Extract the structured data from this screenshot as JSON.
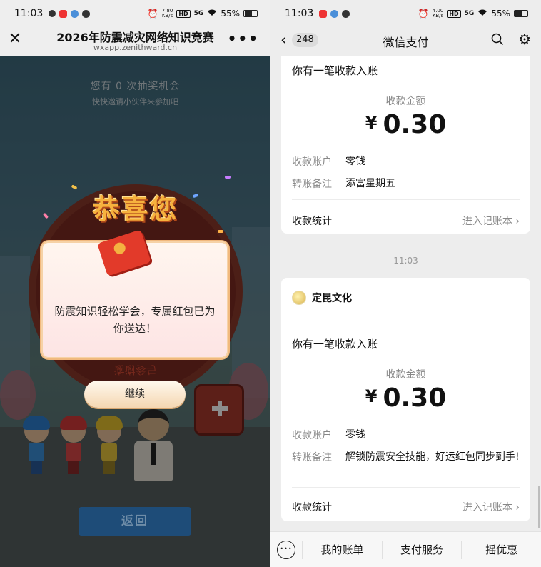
{
  "left": {
    "status": {
      "time": "11:03",
      "speed_num": "7.80",
      "speed_unit": "KB/s",
      "hd": "HD",
      "net": "5G",
      "battery": "55%"
    },
    "header": {
      "close_glyph": "✕",
      "title": "2026年防震减灾网络知识竞赛",
      "url": "wxapp.zenithward.cn",
      "more_glyph": "•••"
    },
    "game": {
      "chances": "您有 0 次抽奖机会",
      "invite": "快快邀请小伙伴来参加吧",
      "back_button": "返回"
    },
    "popup": {
      "congrats": "恭喜您",
      "message": "防震知识轻松学会，专属红包已为你送达！",
      "behind_text": "谢谢参与",
      "continue_button": "继续"
    }
  },
  "right": {
    "status": {
      "time": "11:03",
      "speed_num": "4.00",
      "speed_unit": "KB/s",
      "hd": "HD",
      "net": "5G",
      "battery": "55%"
    },
    "header": {
      "back_glyph": "‹",
      "unread": "248",
      "title": "微信支付",
      "gear_glyph": "⚙"
    },
    "timestamp": "11:03",
    "cards": [
      {
        "heading": "你有一笔收款入账",
        "amount_label": "收款金额",
        "currency": "¥",
        "amount": "0.30",
        "account_label": "收款账户",
        "account_value": "零钱",
        "note_label": "转账备注",
        "note_value": "添富星期五",
        "stats_label": "收款统计",
        "stats_link": "进入记账本 ›"
      },
      {
        "sender": "定昆文化",
        "heading": "你有一笔收款入账",
        "amount_label": "收款金额",
        "currency": "¥",
        "amount": "0.30",
        "account_label": "收款账户",
        "account_value": "零钱",
        "note_label": "转账备注",
        "note_value": "解锁防震安全技能，好运红包同步到手!",
        "stats_label": "收款统计",
        "stats_link": "进入记账本 ›"
      }
    ],
    "bottom_menu": [
      "我的账单",
      "支付服务",
      "摇优惠"
    ]
  },
  "colors": {
    "accent_red": "#e23a2a",
    "gold": "#f6b23e",
    "back_button_bg": "#1e4c78"
  }
}
